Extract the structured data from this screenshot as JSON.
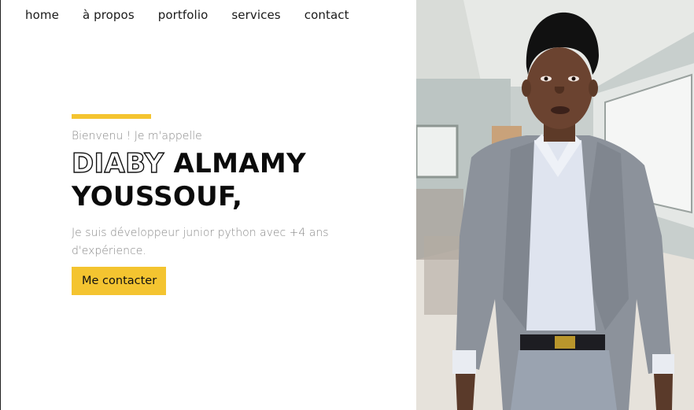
{
  "nav": {
    "items": [
      "home",
      "à propos",
      "portfolio",
      "services",
      "contact"
    ]
  },
  "hero": {
    "greeting": "Bienvenu ! Je m'appelle",
    "name_outline": "DIABY",
    "name_rest_line1": "ALMAMY",
    "name_line2": "YOUSSOUF,",
    "description": "Je suis développeur junior python avec +4 ans d'expérience.",
    "cta_label": "Me contacter"
  },
  "colors": {
    "accent": "#f4c430",
    "text": "#111111",
    "muted": "#8a8a8a"
  }
}
